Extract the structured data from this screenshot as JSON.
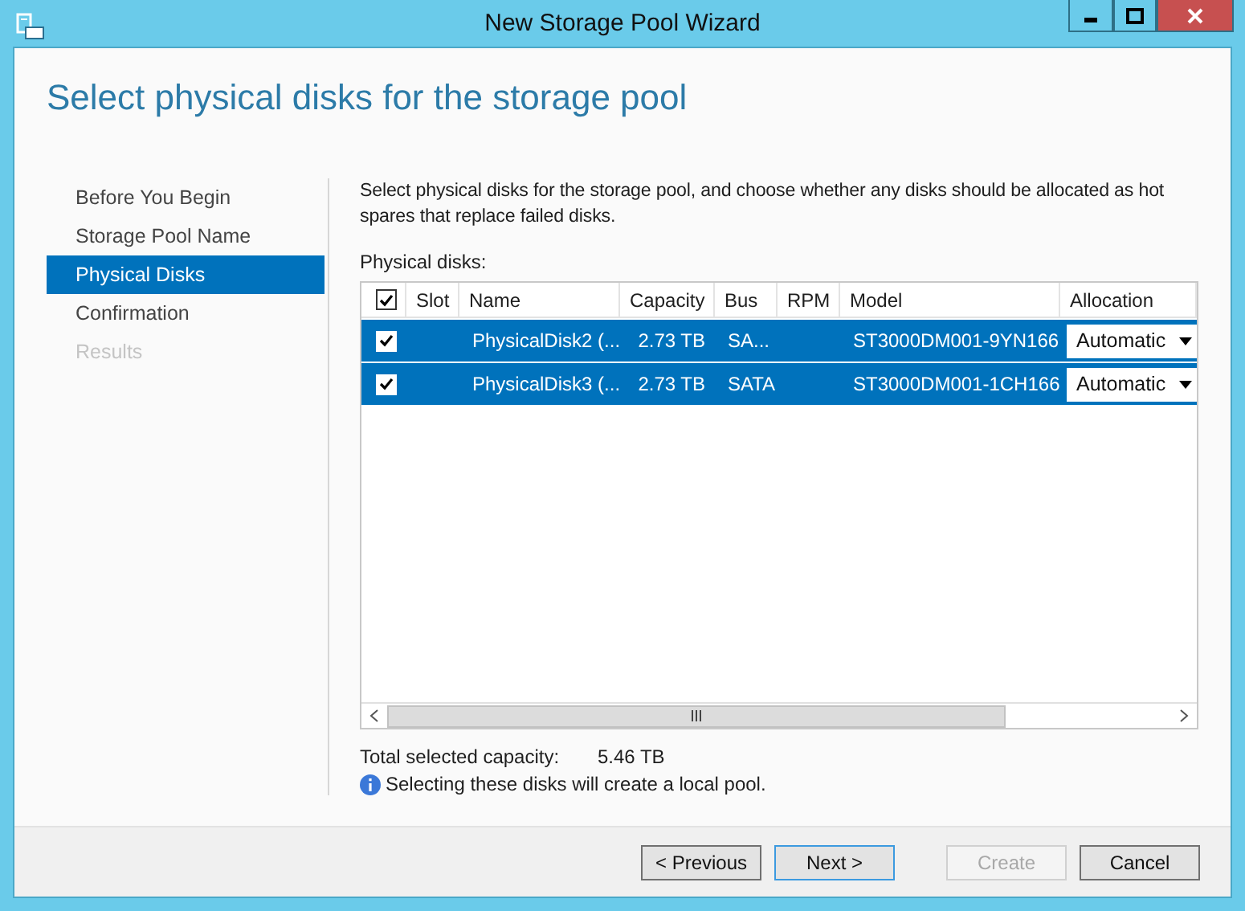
{
  "window": {
    "title": "New Storage Pool Wizard"
  },
  "heading": "Select physical disks for the storage pool",
  "steps": [
    {
      "label": "Before You Begin",
      "selected": false,
      "disabled": false
    },
    {
      "label": "Storage Pool Name",
      "selected": false,
      "disabled": false
    },
    {
      "label": "Physical Disks",
      "selected": true,
      "disabled": false
    },
    {
      "label": "Confirmation",
      "selected": false,
      "disabled": false
    },
    {
      "label": "Results",
      "selected": false,
      "disabled": true
    }
  ],
  "description": "Select physical disks for the storage pool, and choose whether any disks should be allocated as hot spares that replace failed disks.",
  "table": {
    "label": "Physical disks:",
    "select_all_checked": true,
    "columns": [
      "Slot",
      "Name",
      "Capacity",
      "Bus",
      "RPM",
      "Model",
      "Allocation"
    ],
    "rows": [
      {
        "checked": true,
        "selected": true,
        "name": "PhysicalDisk2 (...",
        "capacity": "2.73 TB",
        "bus": "SA...",
        "model": "ST3000DM001-9YN166",
        "allocation": "Automatic"
      },
      {
        "checked": true,
        "selected": true,
        "name": "PhysicalDisk3 (...",
        "capacity": "2.73 TB",
        "bus": "SATA",
        "model": "ST3000DM001-1CH166",
        "allocation": "Automatic"
      }
    ]
  },
  "total": {
    "label": "Total selected capacity:",
    "value": "5.46 TB"
  },
  "info": "Selecting these disks will create a local pool.",
  "buttons": [
    {
      "label": "< Previous",
      "disabled": false,
      "default": false
    },
    {
      "label": "Next >",
      "disabled": false,
      "default": true
    },
    {
      "label": "Create",
      "disabled": true,
      "default": false
    },
    {
      "label": "Cancel",
      "disabled": false,
      "default": false
    }
  ]
}
